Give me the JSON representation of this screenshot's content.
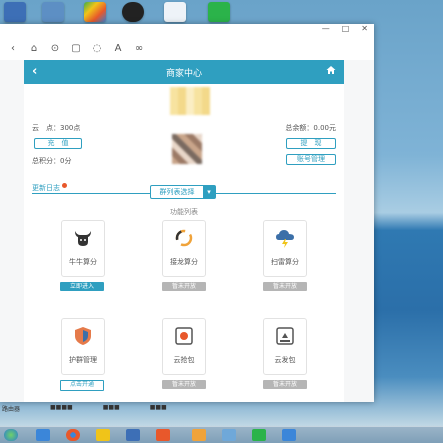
{
  "colors": {
    "accent": "#2f9fc0",
    "disabled": "#b5b5b5",
    "badge": "#e8582b"
  },
  "desktop": {
    "icons": [
      "word-icon",
      "computer-icon",
      "recycle-icon",
      "qq-icon",
      "file-icon",
      "green-icon"
    ],
    "bottom_labels": [
      "路由器",
      "■■■■",
      "■■■",
      "■■■"
    ]
  },
  "browser": {
    "window_controls": [
      "—",
      "□",
      "✕"
    ],
    "toolbar_icons": [
      "‹",
      "⌂",
      "⊙",
      "▢",
      "◌",
      "A",
      "∞"
    ]
  },
  "app": {
    "header_title": "商家中心",
    "cloud_points_label": "云　点：300点",
    "recharge_label": "充　值",
    "total_points_label": "总积分：0分",
    "total_balance_label": "总余额：0.00元",
    "withdraw_label": "提　现",
    "account_manage_label": "账号管理",
    "update_log_label": "更新日志",
    "dropdown_label": "群列表选择",
    "feature_list_label": "功能列表",
    "cards": [
      {
        "name": "牛牛算分",
        "icon": "bull-icon",
        "button": "立即进入"
      },
      {
        "name": "接龙算分",
        "icon": "loop-icon",
        "button": "暂未开放"
      },
      {
        "name": "扫雷算分",
        "icon": "cloud-lightning-icon",
        "button": "暂未开放"
      },
      {
        "name": "护群管理",
        "icon": "shield-icon",
        "button": "点击开通"
      },
      {
        "name": "云抢包",
        "icon": "grab-icon",
        "button": "暂未开放"
      },
      {
        "name": "云发包",
        "icon": "send-icon",
        "button": "暂未开放"
      }
    ]
  }
}
